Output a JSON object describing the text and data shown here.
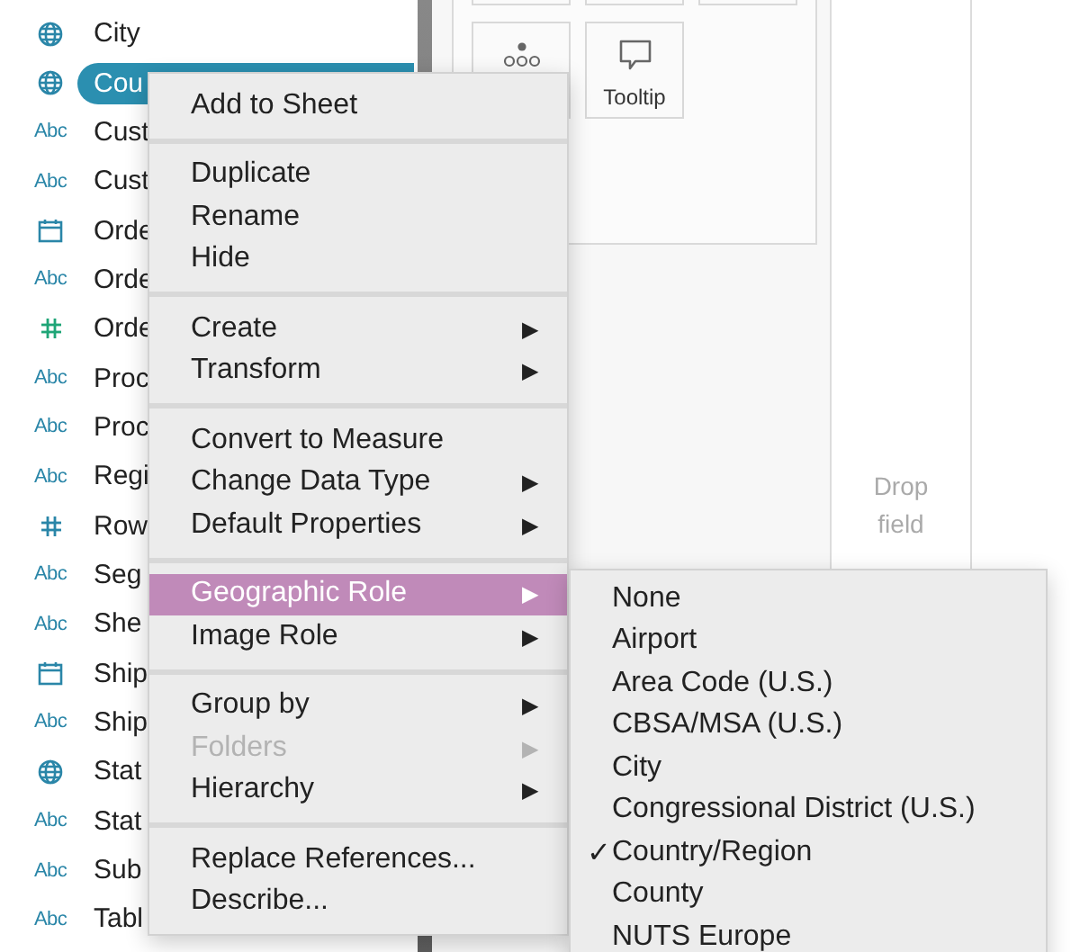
{
  "fields": [
    {
      "kind": "geo",
      "name": "City",
      "selected": false
    },
    {
      "kind": "geo",
      "name": "Cou",
      "selected": true
    },
    {
      "kind": "text",
      "type_label": "Abc",
      "name": "Cust",
      "selected": false
    },
    {
      "kind": "text",
      "type_label": "Abc",
      "name": "Cust",
      "selected": false
    },
    {
      "kind": "date",
      "name": "Orde",
      "selected": false
    },
    {
      "kind": "text",
      "type_label": "Abc",
      "name": "Orde",
      "selected": false
    },
    {
      "kind": "number",
      "color": "#1fa577",
      "name": "Orde",
      "selected": false
    },
    {
      "kind": "text",
      "type_label": "Abc",
      "name": "Proc",
      "selected": false
    },
    {
      "kind": "text",
      "type_label": "Abc",
      "name": "Proc",
      "selected": false
    },
    {
      "kind": "text",
      "type_label": "Abc",
      "name": "Regi",
      "selected": false
    },
    {
      "kind": "number",
      "color": "#2a86a8",
      "name": "Row",
      "selected": false
    },
    {
      "kind": "text",
      "type_label": "Abc",
      "name": "Seg",
      "selected": false
    },
    {
      "kind": "text",
      "type_label": "Abc",
      "name": "She",
      "selected": false
    },
    {
      "kind": "date",
      "name": "Ship",
      "selected": false
    },
    {
      "kind": "text",
      "type_label": "Abc",
      "name": "Ship",
      "selected": false
    },
    {
      "kind": "geo",
      "name": "Stat",
      "selected": false
    },
    {
      "kind": "text",
      "type_label": "Abc",
      "name": "Stat",
      "selected": false
    },
    {
      "kind": "text",
      "type_label": "Abc",
      "name": "Sub",
      "selected": false
    },
    {
      "kind": "text",
      "type_label": "Abc",
      "name": "Tabl",
      "selected": false
    }
  ],
  "marks_cards": [
    {
      "kind": "detail"
    },
    {
      "kind": "tooltip",
      "label": "Tooltip"
    }
  ],
  "drop_zone": {
    "text": "Drop field"
  },
  "context_menu": {
    "groups": [
      {
        "items": [
          {
            "label": "Add to Sheet",
            "disabled": false,
            "selected": false
          }
        ]
      },
      {
        "items": [
          {
            "label": "Duplicate",
            "disabled": false,
            "selected": false
          },
          {
            "label": "Rename",
            "disabled": false,
            "selected": false
          },
          {
            "label": "Hide",
            "disabled": false,
            "selected": false
          }
        ]
      },
      {
        "items": [
          {
            "label": "Create",
            "arrow": "▶",
            "disabled": false,
            "selected": false
          },
          {
            "label": "Transform",
            "arrow": "▶",
            "disabled": false,
            "selected": false
          }
        ]
      },
      {
        "items": [
          {
            "label": "Convert to Measure",
            "disabled": false,
            "selected": false
          },
          {
            "label": "Change Data Type",
            "arrow": "▶",
            "disabled": false,
            "selected": false
          },
          {
            "label": "Default Properties",
            "arrow": "▶",
            "disabled": false,
            "selected": false
          }
        ]
      },
      {
        "items": [
          {
            "label": "Geographic Role",
            "arrow": "▶",
            "disabled": false,
            "selected": true
          },
          {
            "label": "Image Role",
            "arrow": "▶",
            "disabled": false,
            "selected": false
          }
        ]
      },
      {
        "items": [
          {
            "label": "Group by",
            "arrow": "▶",
            "disabled": false,
            "selected": false
          },
          {
            "label": "Folders",
            "arrow": "▶",
            "disabled": true,
            "selected": false
          },
          {
            "label": "Hierarchy",
            "arrow": "▶",
            "disabled": false,
            "selected": false
          }
        ]
      },
      {
        "items": [
          {
            "label": "Replace References...",
            "disabled": false,
            "selected": false
          },
          {
            "label": "Describe...",
            "disabled": false,
            "selected": false
          }
        ]
      }
    ]
  },
  "submenu": {
    "check_mark": "✓",
    "items": [
      {
        "label": "None",
        "checked": false
      },
      {
        "label": "Airport",
        "checked": false
      },
      {
        "label": "Area Code (U.S.)",
        "checked": false
      },
      {
        "label": "CBSA/MSA (U.S.)",
        "checked": false
      },
      {
        "label": "City",
        "checked": false
      },
      {
        "label": "Congressional District (U.S.)",
        "checked": false
      },
      {
        "label": "Country/Region",
        "checked": true
      },
      {
        "label": "County",
        "checked": false
      },
      {
        "label": "NUTS Europe",
        "checked": false
      }
    ]
  }
}
